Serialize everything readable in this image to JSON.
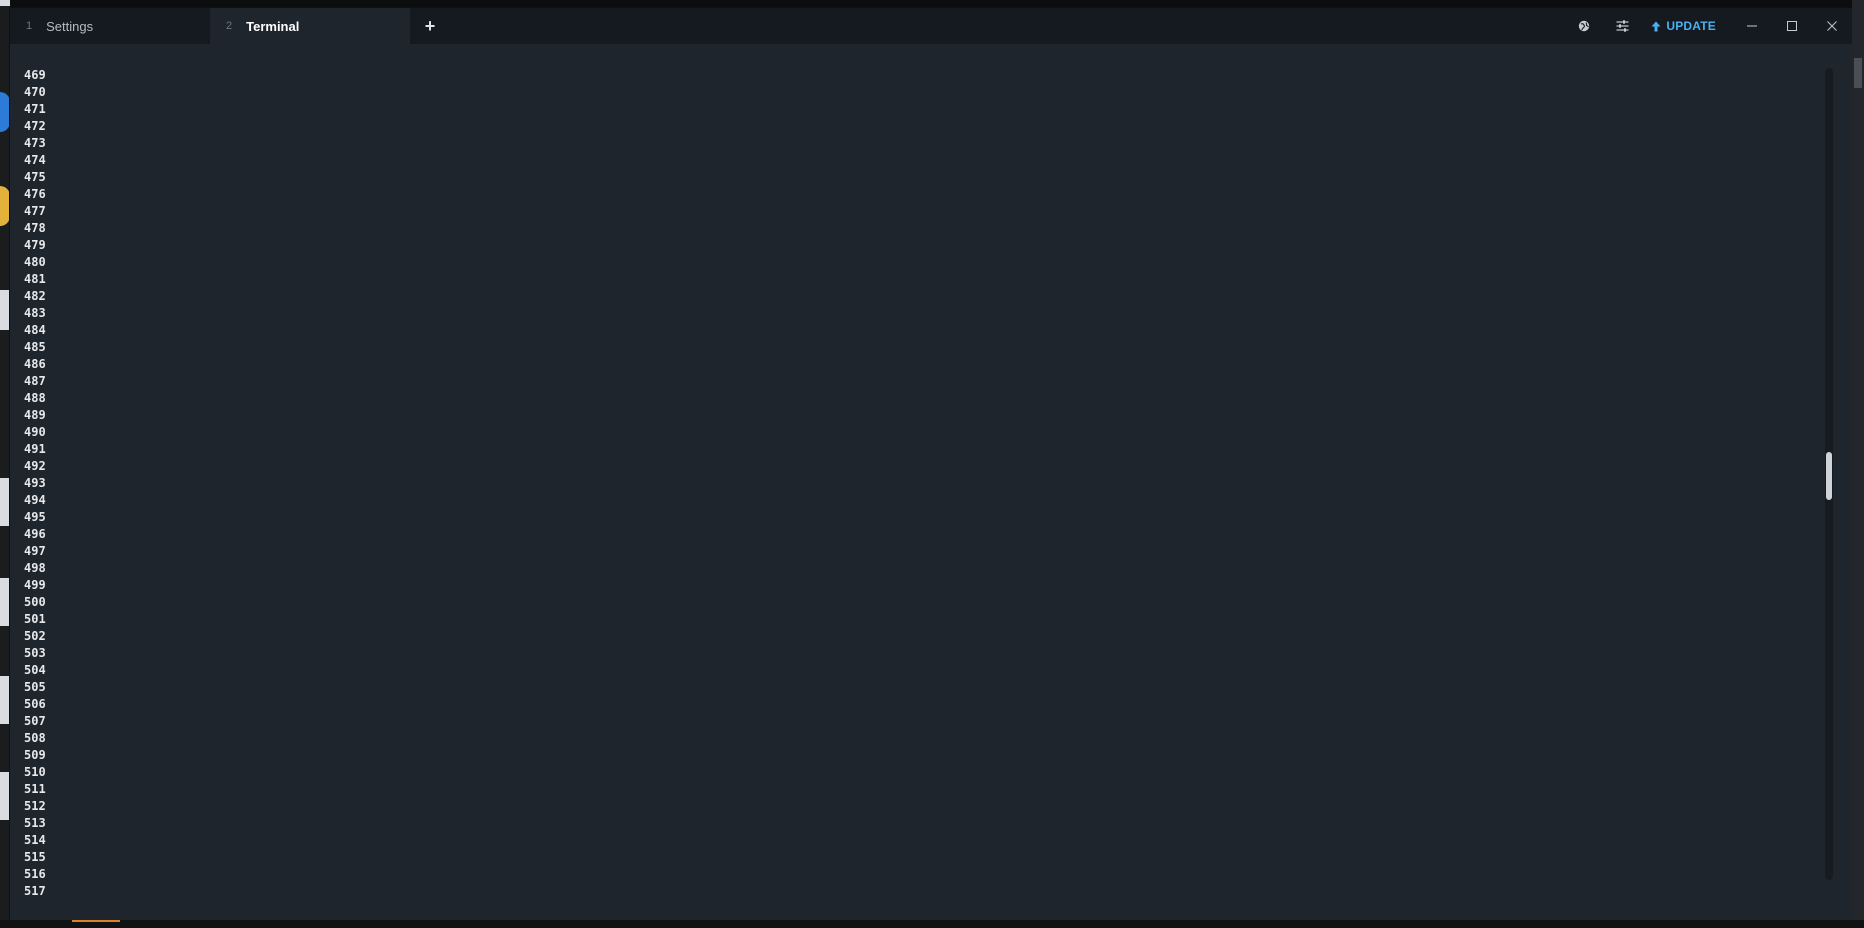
{
  "tabs": [
    {
      "number": "1",
      "label": "Settings",
      "active": false
    },
    {
      "number": "2",
      "label": "Terminal",
      "active": true
    }
  ],
  "new_tab_label": "+",
  "update_button": {
    "label": "UPDATE",
    "color": "#4ab0f2"
  },
  "toolbar_icons": [
    "globe-icon",
    "sliders-icon"
  ],
  "window_controls": [
    "minimize-icon",
    "maximize-icon",
    "close-icon"
  ],
  "terminal": {
    "line_numbers": [
      "469",
      "470",
      "471",
      "472",
      "473",
      "474",
      "475",
      "476",
      "477",
      "478",
      "479",
      "480",
      "481",
      "482",
      "483",
      "484",
      "485",
      "486",
      "487",
      "488",
      "489",
      "490",
      "491",
      "492",
      "493",
      "494",
      "495",
      "496",
      "497",
      "498",
      "499",
      "500",
      "501",
      "502",
      "503",
      "504",
      "505",
      "506",
      "507",
      "508",
      "509",
      "510",
      "511",
      "512",
      "513",
      "514",
      "515",
      "516",
      "517"
    ]
  },
  "colors": {
    "background": "#1f252d",
    "tabbar": "#151a20",
    "accent": "#4ab0f2"
  }
}
